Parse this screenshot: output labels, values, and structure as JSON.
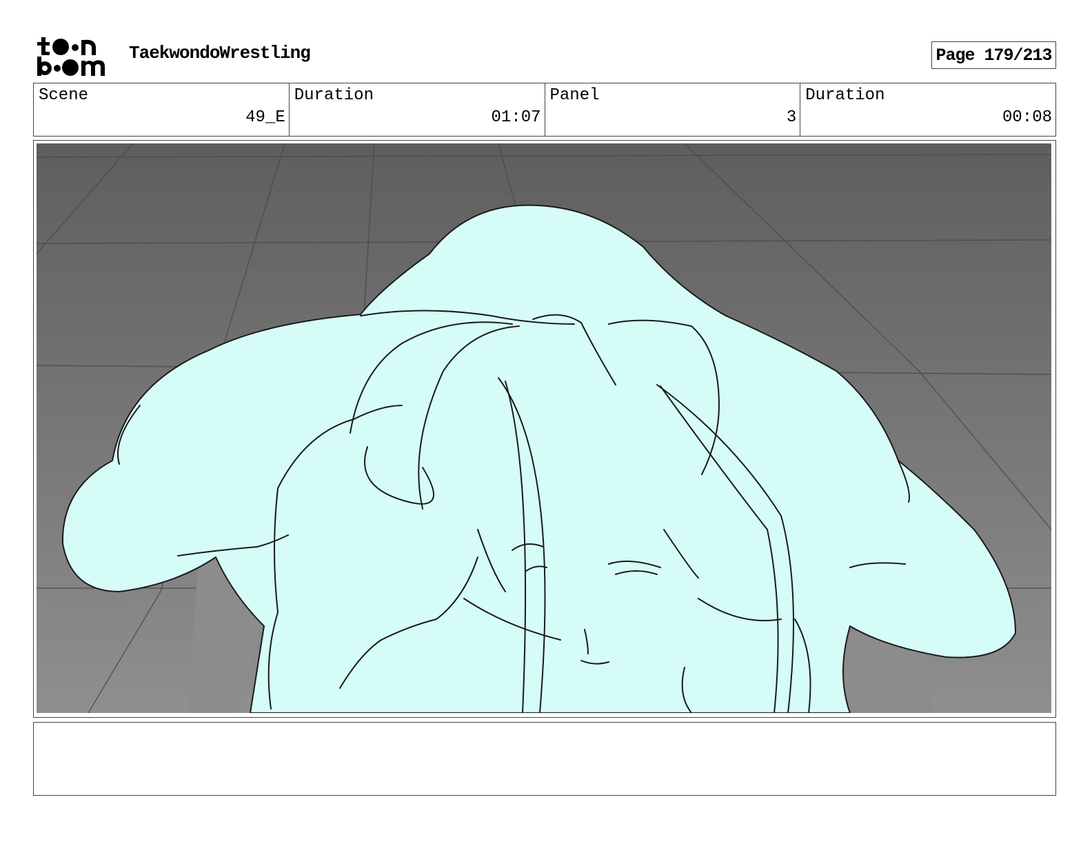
{
  "header": {
    "logo": "toon boom",
    "project_title": "TaekwondoWrestling",
    "page_label": "Page 179/213"
  },
  "info": [
    {
      "label": "Scene",
      "value": "49_E"
    },
    {
      "label": "Duration",
      "value": "01:07"
    },
    {
      "label": "Panel",
      "value": "3"
    },
    {
      "label": "Duration",
      "value": "00:08"
    }
  ],
  "panel": {
    "floor_color": "#6e6e6e",
    "character_fill": "#d6fcf8",
    "line_color": "#1a1a1a"
  },
  "notes": {
    "text": ""
  }
}
